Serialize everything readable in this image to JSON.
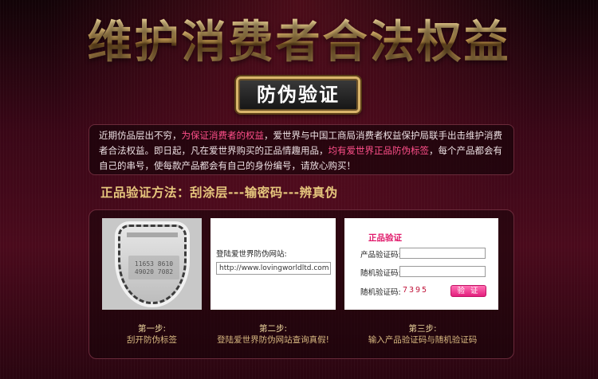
{
  "header": {
    "headline": "维护消费者合法权益",
    "badge": "防伪验证"
  },
  "intro": {
    "part1": "近期仿品层出不穷，",
    "highlight1": "为保证消费者的权益",
    "part2": "，爱世界与中国工商局消费者权益保护局联手出击维护消费者合法权益。即日起，凡在爱世界购买的正品情趣用品，",
    "highlight2": "均有爱世界正品防伪标签",
    "part3": "，每个产品都会有自己的串号，使每款产品都会有自己的身份编号，请放心购买！"
  },
  "method": {
    "heading": "正品验证方法：刮涂层---输密码---辨真伪"
  },
  "step1": {
    "label_serial_1": "11653 8610",
    "label_serial_2": "49020 7082",
    "title": "第一步:",
    "desc": "刮开防伪标签"
  },
  "step2": {
    "site_label": "登陆爱世界防伪网站:",
    "site_url": "http://www.lovingworldltd.com",
    "title": "第二步:",
    "desc": "登陆爱世界防伪网站查询真假!"
  },
  "step3": {
    "form_title": "正品验证",
    "product_code_label": "产品验证码:",
    "random_code_label": "随机验证码:",
    "random_code2_label": "随机验证码:",
    "captcha": "7395",
    "verify_button": "验  证",
    "title": "第三步:",
    "desc": "输入产品验证码与随机验证码"
  },
  "colors": {
    "accent_pink": "#e0186a",
    "gold": "#e6c67d",
    "background": "#3a0717"
  }
}
